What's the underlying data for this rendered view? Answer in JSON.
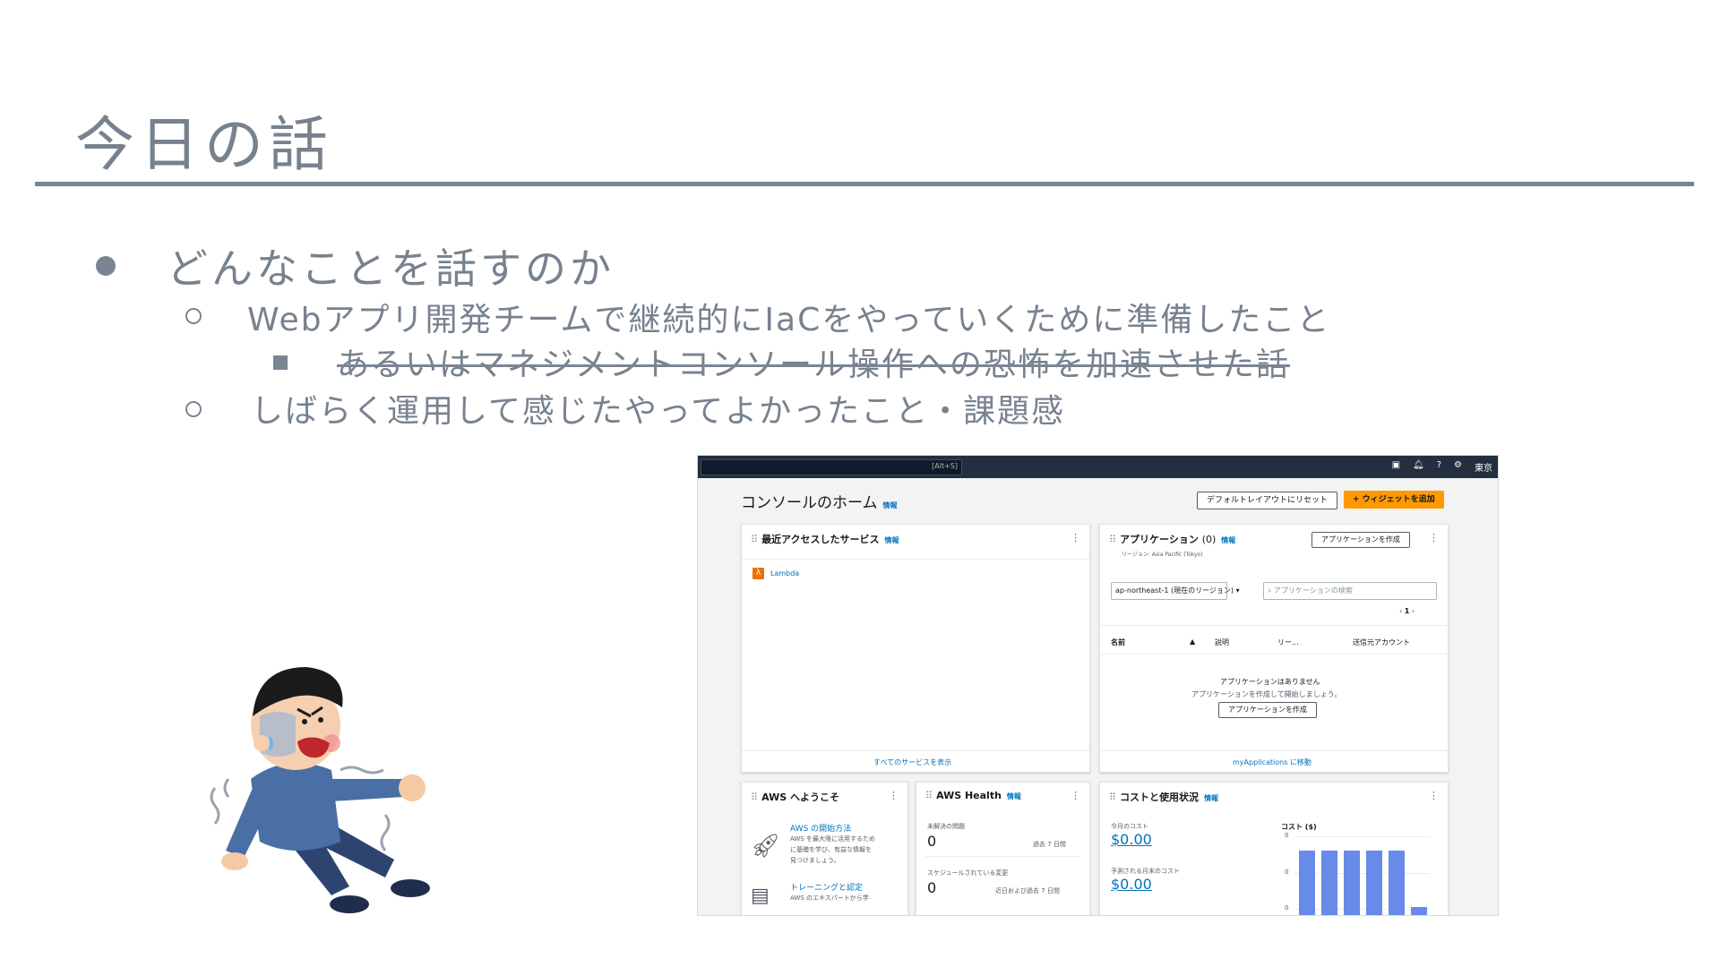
{
  "slide": {
    "title": "今日の話",
    "bullets": [
      {
        "text": "どんなことを話すのか"
      },
      {
        "text": "Webアプリ開発チームで継続的にIaCをやっていくために準備したこと"
      },
      {
        "text": "あるいはマネジメントコンソール操作への恐怖を加速させた話"
      },
      {
        "text": "しばらく運用して感じたやってよかったこと・課題感"
      }
    ]
  },
  "console": {
    "search_hint": "[Alt+S]",
    "region": "東京",
    "home_title": "コンソールのホーム",
    "info": "情報",
    "reset_layout": "デフォルトレイアウトにリセット",
    "add_widget": "+ ウィジェットを追加",
    "recent": {
      "title": "最近アクセスしたサービス",
      "items": [
        "Lambda"
      ],
      "footer": "すべてのサービスを表示"
    },
    "apps": {
      "title": "アプリケーション",
      "count": "(0)",
      "region_label": "リージョン: Asia Pacific (Tokyo)",
      "create": "アプリケーションを作成",
      "region_select": "ap-northeast-1 (現在のリージョン)",
      "search_placeholder": "アプリケーションの検索",
      "page": "1",
      "columns": [
        "名前",
        "説明",
        "リー...",
        "送信元アカウント"
      ],
      "empty_title": "アプリケーションはありません",
      "empty_body": "アプリケーションを作成して開始しましょう。",
      "empty_button": "アプリケーションを作成",
      "footer": "myApplications に移動"
    },
    "welcome": {
      "title": "AWS へようこそ",
      "link1": "AWS の開始方法",
      "desc1_line1": "AWS を最大限に活用するため",
      "desc1_line2": "に基礎を学び、有益な情報を",
      "desc1_line3": "見つけましょう。",
      "link2": "トレーニングと認定",
      "desc2_line1": "AWS のエキスパートから学"
    },
    "health": {
      "title": "AWS Health",
      "open_issues": "未解決の問題",
      "open_value": "0",
      "open_period": "過去 7 日間",
      "scheduled": "スケジュールされている変更",
      "scheduled_value": "0",
      "scheduled_period": "近日および過去 7 日間"
    },
    "cost": {
      "title": "コストと使用状況",
      "month_label": "今月のコスト",
      "month_value": "$0.00",
      "forecast_label": "予測される月末のコスト",
      "forecast_value": "$0.00",
      "chart_title": "コスト ($)"
    }
  },
  "chart_data": {
    "type": "bar",
    "title": "コスト ($)",
    "categories": [
      "",
      "",
      "",
      "",
      "",
      ""
    ],
    "values": [
      0.82,
      0.82,
      0.82,
      0.82,
      0.82,
      0.12
    ],
    "ytick_labels": [
      "0",
      "0",
      "0"
    ],
    "color": "#688ae8"
  }
}
